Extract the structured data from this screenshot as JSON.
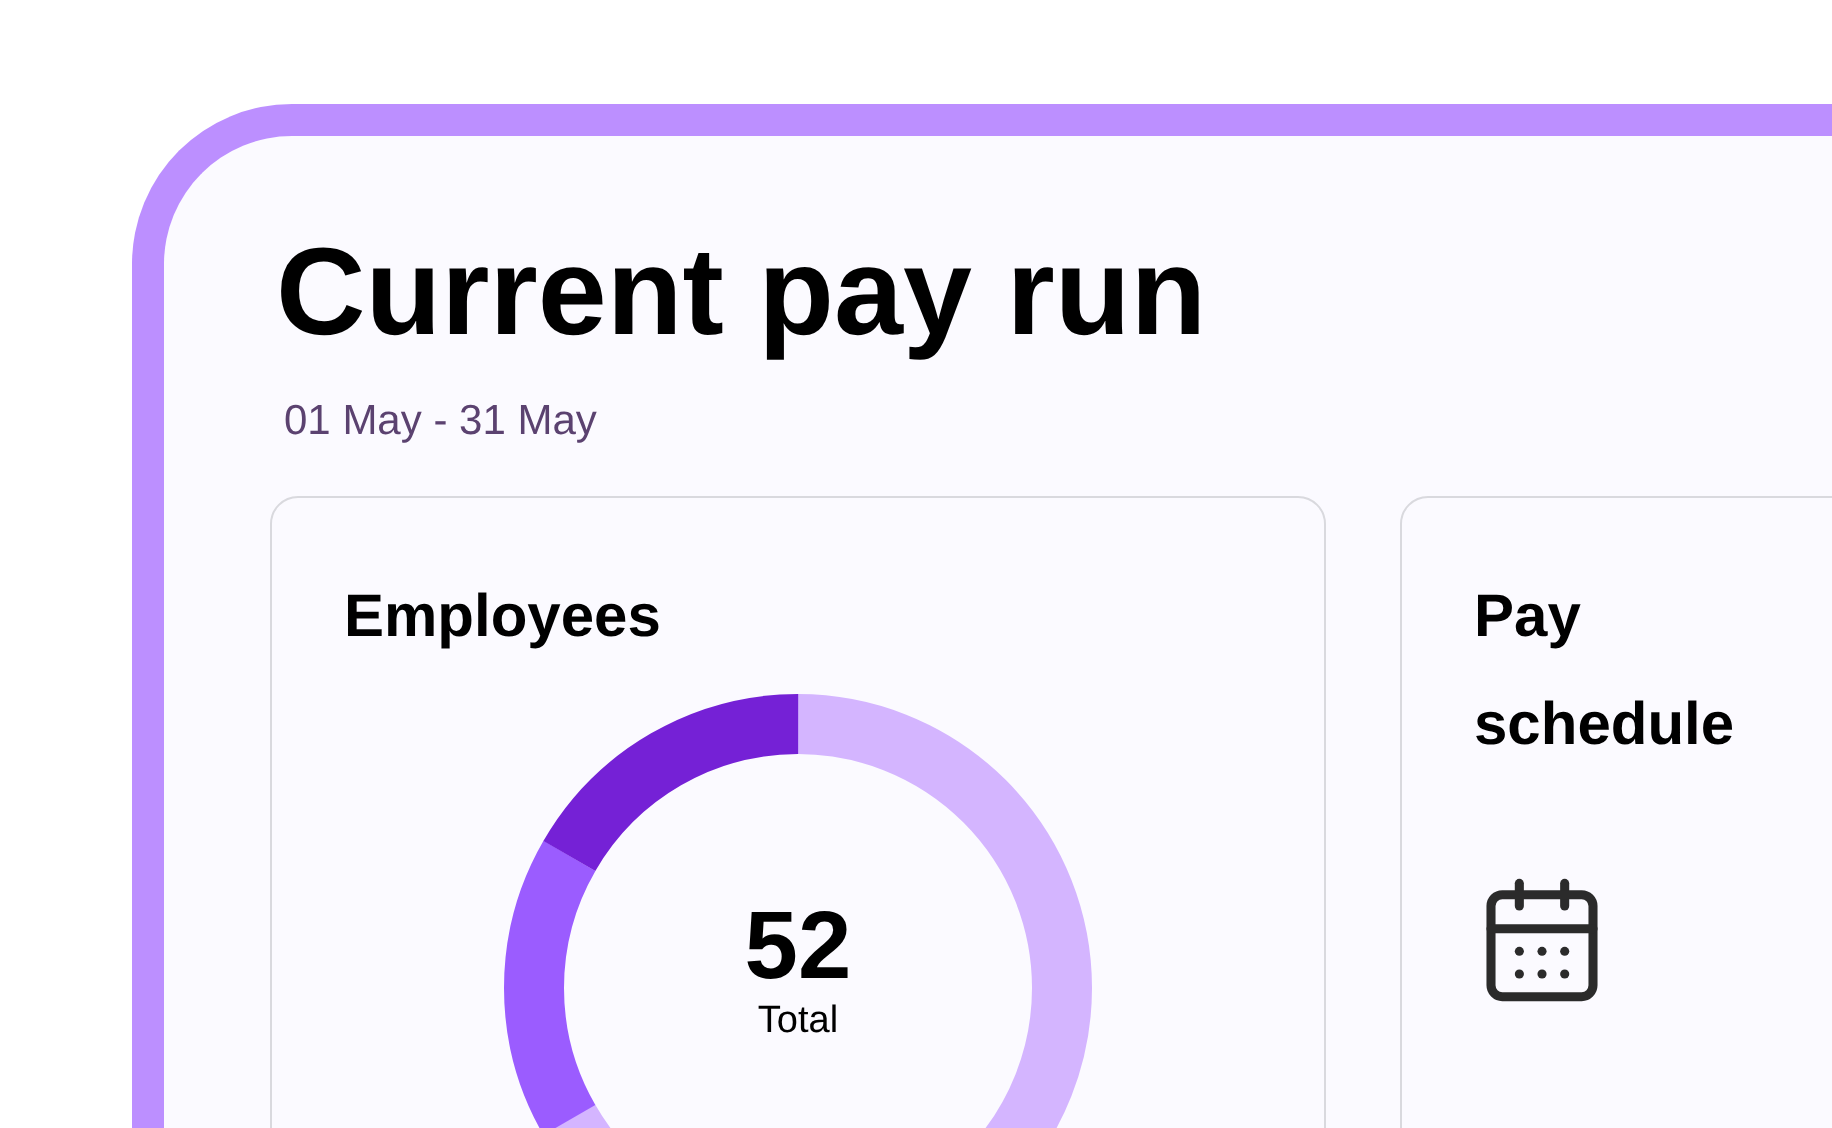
{
  "title": "Current pay run",
  "date_range": "01 May - 31 May",
  "cards": [
    {
      "kind": "employees",
      "title": "Employees",
      "total": "52",
      "total_label": "Total"
    },
    {
      "kind": "schedule",
      "title": "Pay schedule"
    }
  ]
}
